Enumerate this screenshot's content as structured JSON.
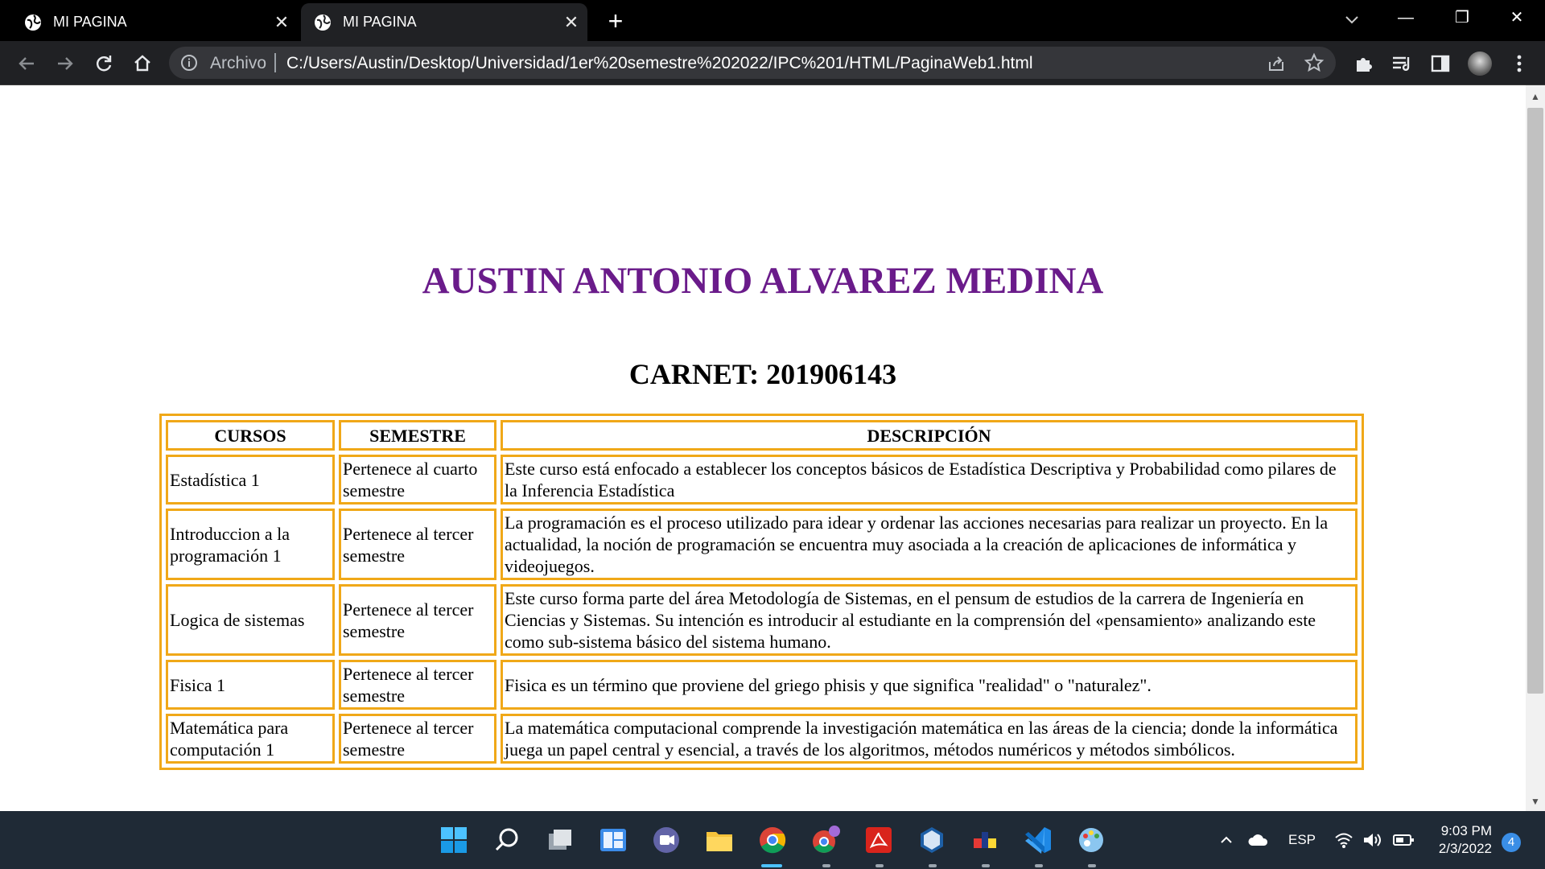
{
  "browser": {
    "tabs": [
      {
        "title": "MI PAGINA",
        "active": false
      },
      {
        "title": "MI PAGINA",
        "active": true
      }
    ],
    "new_tab_symbol": "+",
    "close_symbol": "✕",
    "window_controls": {
      "minimize": "—",
      "restore": "❐",
      "close": "✕"
    },
    "address": {
      "prefix": "Archivo",
      "url": "C:/Users/Austin/Desktop/Universidad/1er%20semestre%202022/IPC%201/HTML/PaginaWeb1.html"
    }
  },
  "page": {
    "title": "AUSTIN ANTONIO ALVAREZ MEDINA",
    "subtitle": "CARNET: 201906143",
    "table": {
      "headers": [
        "CURSOS",
        "SEMESTRE",
        "DESCRIPCIÓN"
      ],
      "rows": [
        [
          "Estadística 1",
          "Pertenece al cuarto semestre",
          "Este curso está enfocado a establecer los conceptos básicos de Estadística Descriptiva y Probabilidad como pilares de la Inferencia Estadística"
        ],
        [
          "Introduccion a la programación 1",
          "Pertenece al tercer semestre",
          "La programación es el proceso utilizado para idear y ordenar las acciones necesarias para realizar un proyecto. En la actualidad, la noción de programación se encuentra muy asociada a la creación de aplicaciones de informática y videojuegos."
        ],
        [
          "Logica de sistemas",
          "Pertenece al tercer semestre",
          "Este curso forma parte del área Metodología de Sistemas, en el pensum de estudios de la carrera de Ingeniería en Ciencias y Sistemas. Su intención es introducir al estudiante en la comprensión del «pensamiento» analizando este como sub-sistema básico del sistema humano."
        ],
        [
          "Fisica 1",
          "Pertenece al tercer semestre",
          "Fisica es un término que proviene del griego phisis y que significa \"realidad\" o \"naturalez\"."
        ],
        [
          "Matemática para computación 1",
          "Pertenece al tercer semestre",
          "La matemática computacional comprende la investigación matemática en las áreas de la ciencia; donde la informática juega un papel central y esencial, a través de los algoritmos, métodos numéricos y métodos simbólicos."
        ]
      ]
    }
  },
  "taskbar": {
    "apps": [
      "windows-start-icon",
      "search-icon",
      "task-view-icon",
      "widgets-icon",
      "teams-chat-icon",
      "file-explorer-icon",
      "chrome-icon",
      "chrome-profile-icon",
      "acrobat-icon",
      "virtualbox-icon",
      "app-icon",
      "vscode-icon",
      "paint-icon"
    ],
    "tray": {
      "language": "ESP"
    },
    "clock": {
      "time": "9:03 PM",
      "date": "2/3/2022"
    },
    "notification_count": "4"
  },
  "colors": {
    "title": "#6a1b8a",
    "table_border": "#f0a818",
    "chrome_dark": "#202124"
  }
}
